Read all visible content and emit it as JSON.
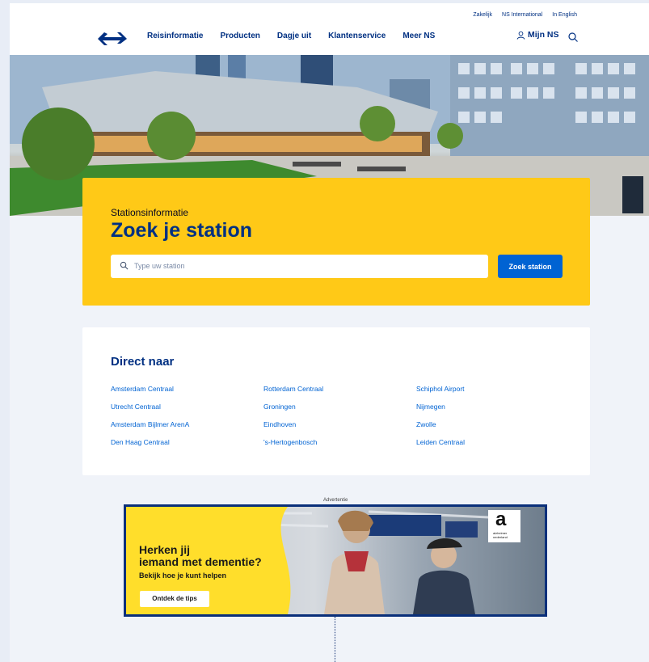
{
  "header": {
    "top_links": [
      "Zakelijk",
      "NS International",
      "In English"
    ],
    "nav": [
      "Reisinformatie",
      "Producten",
      "Dagje uit",
      "Klantenservice",
      "Meer NS"
    ],
    "account_label": "Mijn NS"
  },
  "search_panel": {
    "subtitle": "Stationsinformatie",
    "title": "Zoek je station",
    "input_placeholder": "Type uw station",
    "button_label": "Zoek station"
  },
  "direct": {
    "title": "Direct naar",
    "columns": [
      [
        "Amsterdam Centraal",
        "Utrecht Centraal",
        "Amsterdam Bijlmer ArenA",
        "Den Haag Centraal"
      ],
      [
        "Rotterdam Centraal",
        "Groningen",
        "Eindhoven",
        "'s-Hertogenbosch"
      ],
      [
        "Schiphol Airport",
        "Nijmegen",
        "Zwolle",
        "Leiden Centraal"
      ]
    ]
  },
  "ad": {
    "label": "Advertentie",
    "headline_line1": "Herken jij",
    "headline_line2": "iemand met dementie?",
    "subline": "Bekijk hoe je kunt helpen",
    "cta": "Ontdek de tips",
    "logo_letter": "a",
    "logo_line1": "alzheimer",
    "logo_line2": "nederland"
  },
  "colors": {
    "ns_yellow": "#ffc917",
    "ns_blue": "#003082",
    "button_blue": "#0063d3",
    "ad_yellow": "#ffde2b"
  }
}
